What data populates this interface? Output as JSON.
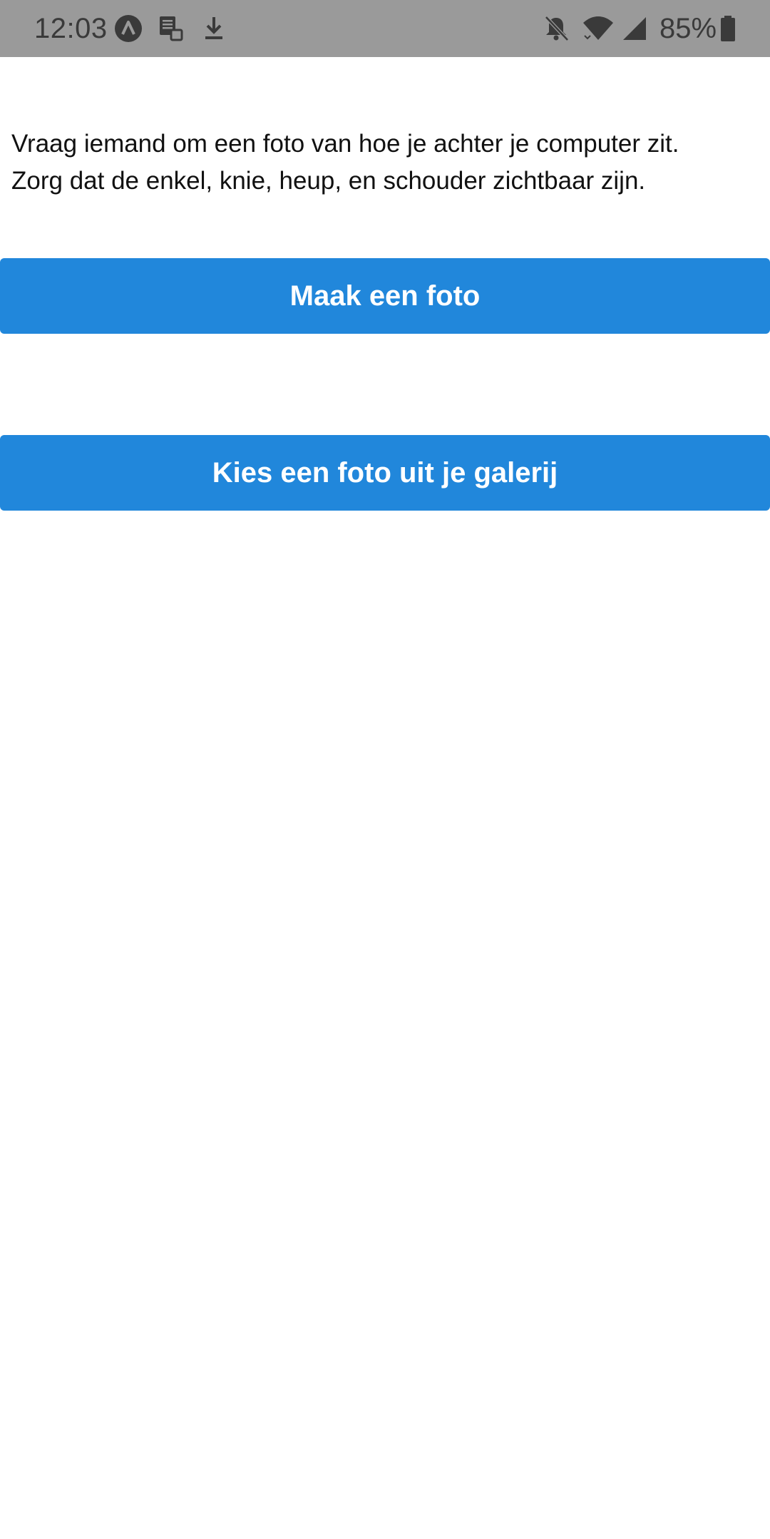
{
  "status_bar": {
    "time": "12:03",
    "battery_percent": "85%",
    "left_icons": [
      "app-a-icon",
      "stack-notification-icon",
      "download-icon"
    ],
    "right_icons": [
      "bell-muted-icon",
      "wifi-icon",
      "signal-icon",
      "battery-icon"
    ],
    "background_color": "#9a9a9a"
  },
  "main": {
    "instruction_line_1": "Vraag iemand om een foto van hoe je achter je computer zit.",
    "instruction_line_2": "Zorg dat de enkel, knie, heup, en schouder zichtbaar zijn.",
    "take_photo_label": "Maak een foto",
    "gallery_label": "Kies een foto uit je galerij",
    "accent_color": "#2187db"
  }
}
